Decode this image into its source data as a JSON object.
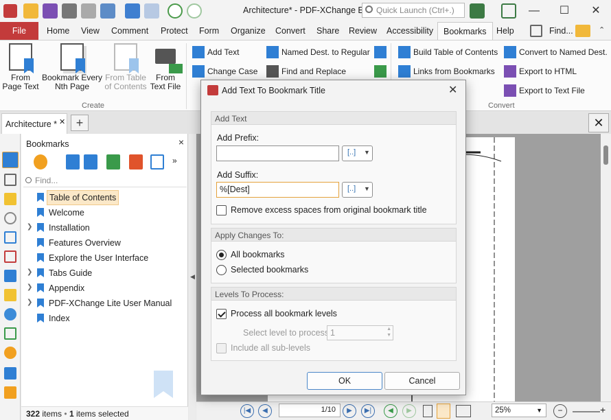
{
  "window": {
    "title": "Architecture* - PDF-XChange E...",
    "quick_launch_placeholder": "Quick Launch (Ctrl+.)",
    "minimize": "—",
    "maximize": "☐",
    "close": "✕"
  },
  "ribbon_tabs": [
    "File",
    "Home",
    "View",
    "Comment",
    "Protect",
    "Form",
    "Organize",
    "Convert",
    "Share",
    "Review",
    "Accessibility",
    "Bookmarks",
    "Help"
  ],
  "ribbon_find": "Find...",
  "ribbon": {
    "create": {
      "label": "Create",
      "from_page_text": [
        "From",
        "Page Text"
      ],
      "every_nth_page": [
        "Bookmark Every",
        "Nth Page"
      ],
      "from_table": [
        "From Table",
        "of Contents"
      ],
      "from_text_file": [
        "From",
        "Text File"
      ]
    },
    "edit": {
      "add_text": "Add Text",
      "change_case": "Change Case",
      "named_dest_to_regular": "Named Dest. to Regular",
      "find_and_replace": "Find and Replace"
    },
    "convert": {
      "label": "Convert",
      "build_toc": "Build Table of Contents",
      "links_from_bookmarks": "Links from Bookmarks",
      "convert_to_named_dest": "Convert to Named Dest.",
      "export_to_html": "Export to HTML",
      "export_to_text_file": "Export to Text File"
    }
  },
  "doc_tabs": {
    "active": "Architecture *",
    "add": "+",
    "close": "✕"
  },
  "bookmarks_panel": {
    "title": "Bookmarks",
    "close": "×",
    "find_placeholder": "Find...",
    "items": [
      {
        "label": "Table of Contents",
        "expandable": false,
        "selected": true
      },
      {
        "label": "Welcome",
        "expandable": false,
        "selected": false
      },
      {
        "label": "Installation",
        "expandable": true,
        "selected": false
      },
      {
        "label": "Features Overview",
        "expandable": false,
        "selected": false
      },
      {
        "label": "Explore the User Interface",
        "expandable": false,
        "selected": false
      },
      {
        "label": "Tabs Guide",
        "expandable": true,
        "selected": false
      },
      {
        "label": "Appendix",
        "expandable": true,
        "selected": false
      },
      {
        "label": "PDF-XChange Lite User Manual",
        "expandable": true,
        "selected": false
      },
      {
        "label": "Index",
        "expandable": false,
        "selected": false
      }
    ],
    "status_count": "322",
    "status_items": "items",
    "status_selected_count": "1",
    "status_selected": "items selected"
  },
  "bottom_nav": {
    "page": "1/10",
    "zoom": "25%"
  },
  "dialog": {
    "title": "Add Text To Bookmark Title",
    "close": "✕",
    "add_text": {
      "header": "Add Text",
      "prefix_label": "Add Prefix:",
      "prefix_value": "",
      "suffix_label": "Add Suffix:",
      "suffix_value": "%[Dest]",
      "macro_glyph": "[..]",
      "remove_spaces_label": "Remove excess spaces from original bookmark title",
      "remove_spaces_checked": false
    },
    "apply_to": {
      "header": "Apply Changes To:",
      "all": "All bookmarks",
      "selected": "Selected bookmarks",
      "choice": "all"
    },
    "levels": {
      "header": "Levels To Process:",
      "process_all_label": "Process all bookmark levels",
      "process_all_checked": true,
      "select_level_label": "Select level to process:",
      "select_level_value": "1",
      "include_sub_label": "Include all sub-levels",
      "include_sub_checked": false
    },
    "ok": "OK",
    "cancel": "Cancel"
  },
  "colors": {
    "accent": "#2f7fd4",
    "file_tab": "#c33b3b",
    "focus": "#e4a23b"
  }
}
